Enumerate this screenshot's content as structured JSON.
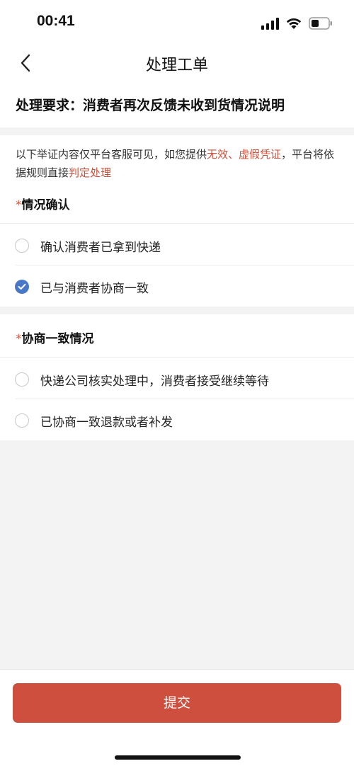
{
  "status_bar": {
    "time": "00:41"
  },
  "nav": {
    "title": "处理工单",
    "back_icon": "chevron-left-icon"
  },
  "requirement": {
    "text": "处理要求：消费者再次反馈未收到货情况说明"
  },
  "notice": {
    "part1": "以下举证内容仅平台客服可见，如您提供",
    "highlight1": "无效、虚假凭证",
    "part2": "，平台将依据规则直接",
    "highlight2": "判定处理",
    "highlight_color": "#c9503a"
  },
  "situation_confirm": {
    "required_mark": "*",
    "title": "情况确认",
    "options": [
      {
        "label": "确认消费者已拿到快递",
        "checked": false
      },
      {
        "label": "已与消费者协商一致",
        "checked": true
      }
    ]
  },
  "negotiation": {
    "required_mark": "*",
    "title": "协商一致情况",
    "options": [
      {
        "label": "快递公司核实处理中，消费者接受继续等待",
        "checked": false
      },
      {
        "label": "已协商一致退款或者补发",
        "checked": false
      }
    ]
  },
  "footer": {
    "submit_label": "提交",
    "button_color": "#cf4f3e"
  },
  "colors": {
    "accent": "#4a78c8",
    "danger": "#cf4f3e"
  }
}
